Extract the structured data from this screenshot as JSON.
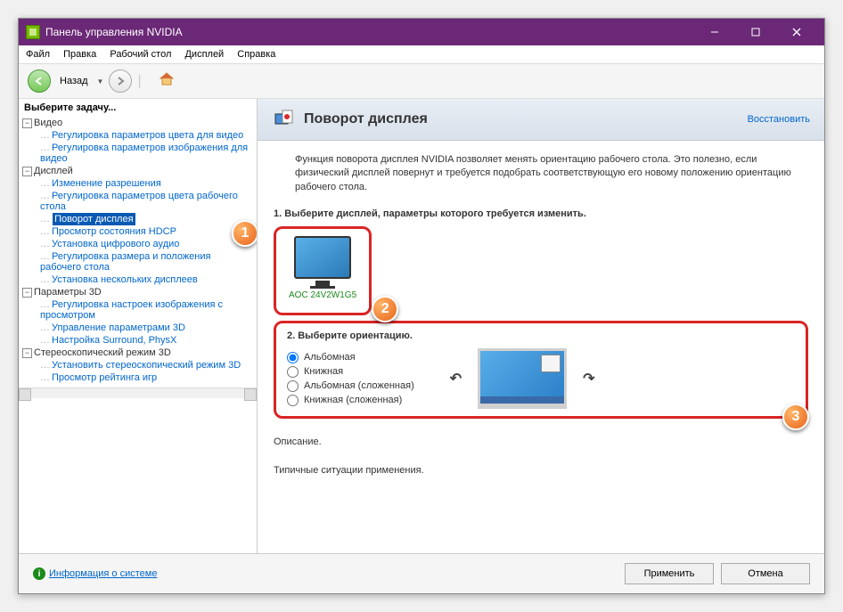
{
  "window": {
    "title": "Панель управления NVIDIA"
  },
  "menu": {
    "file": "Файл",
    "edit": "Правка",
    "desktop": "Рабочий стол",
    "display": "Дисплей",
    "help": "Справка"
  },
  "toolbar": {
    "back": "Назад"
  },
  "sidebar": {
    "title": "Выберите задачу...",
    "video": {
      "label": "Видео",
      "items": [
        "Регулировка параметров цвета для видео",
        "Регулировка параметров изображения для видео"
      ]
    },
    "display": {
      "label": "Дисплей",
      "items": [
        "Изменение разрешения",
        "Регулировка параметров цвета рабочего стола",
        "Поворот дисплея",
        "Просмотр состояния HDCP",
        "Установка цифрового аудио",
        "Регулировка размера и положения рабочего стола",
        "Установка нескольких дисплеев"
      ]
    },
    "params3d": {
      "label": "Параметры 3D",
      "items": [
        "Регулировка настроек изображения с просмотром",
        "Управление параметрами 3D",
        "Настройка Surround, PhysX"
      ]
    },
    "stereo": {
      "label": "Стереоскопический режим 3D",
      "items": [
        "Установить стереоскопический режим 3D",
        "Просмотр рейтинга игр"
      ]
    }
  },
  "content": {
    "title": "Поворот дисплея",
    "restore": "Восстановить",
    "description": "Функция поворота дисплея NVIDIA позволяет менять ориентацию рабочего стола. Это полезно, если физический дисплей повернут и требуется подобрать соответствующую его новому положению ориентацию рабочего стола.",
    "step1": "1. Выберите дисплей, параметры которого требуется изменить.",
    "display_name": "AOC 24V2W1G5",
    "step2": "2. Выберите ориентацию.",
    "orientations": [
      "Альбомная",
      "Книжная",
      "Альбомная (сложенная)",
      "Книжная (сложенная)"
    ],
    "desc_heading": "Описание.",
    "typical": "Типичные ситуации применения."
  },
  "callouts": {
    "c1": "1",
    "c2": "2",
    "c3": "3"
  },
  "footer": {
    "sysinfo": "Информация о системе",
    "apply": "Применить",
    "cancel": "Отмена"
  }
}
